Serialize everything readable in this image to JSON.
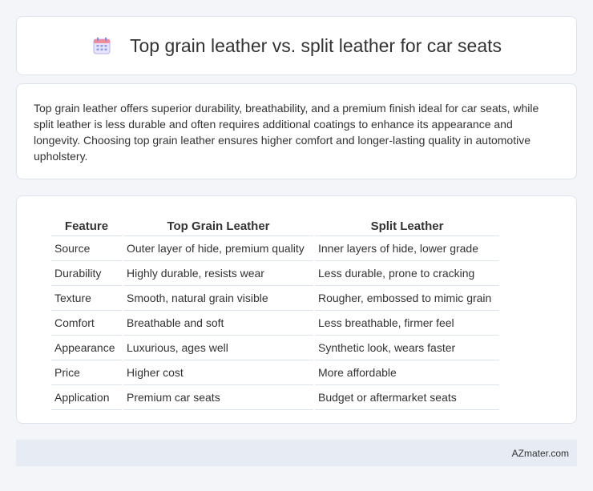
{
  "header": {
    "icon": "calendar-icon",
    "title": "Top grain leather vs. split leather for car seats"
  },
  "summary": {
    "text": "Top grain leather offers superior durability, breathability, and a premium finish ideal for car seats, while split leather is less durable and often requires additional coatings to enhance its appearance and longevity. Choosing top grain leather ensures higher comfort and longer-lasting quality in automotive upholstery."
  },
  "table": {
    "headers": [
      "Feature",
      "Top Grain Leather",
      "Split Leather"
    ],
    "rows": [
      [
        "Source",
        "Outer layer of hide, premium quality",
        "Inner layers of hide, lower grade"
      ],
      [
        "Durability",
        "Highly durable, resists wear",
        "Less durable, prone to cracking"
      ],
      [
        "Texture",
        "Smooth, natural grain visible",
        "Rougher, embossed to mimic grain"
      ],
      [
        "Comfort",
        "Breathable and soft",
        "Less breathable, firmer feel"
      ],
      [
        "Appearance",
        "Luxurious, ages well",
        "Synthetic look, wears faster"
      ],
      [
        "Price",
        "Higher cost",
        "More affordable"
      ],
      [
        "Application",
        "Premium car seats",
        "Budget or aftermarket seats"
      ]
    ]
  },
  "footer": {
    "text": "AZmater.com"
  }
}
